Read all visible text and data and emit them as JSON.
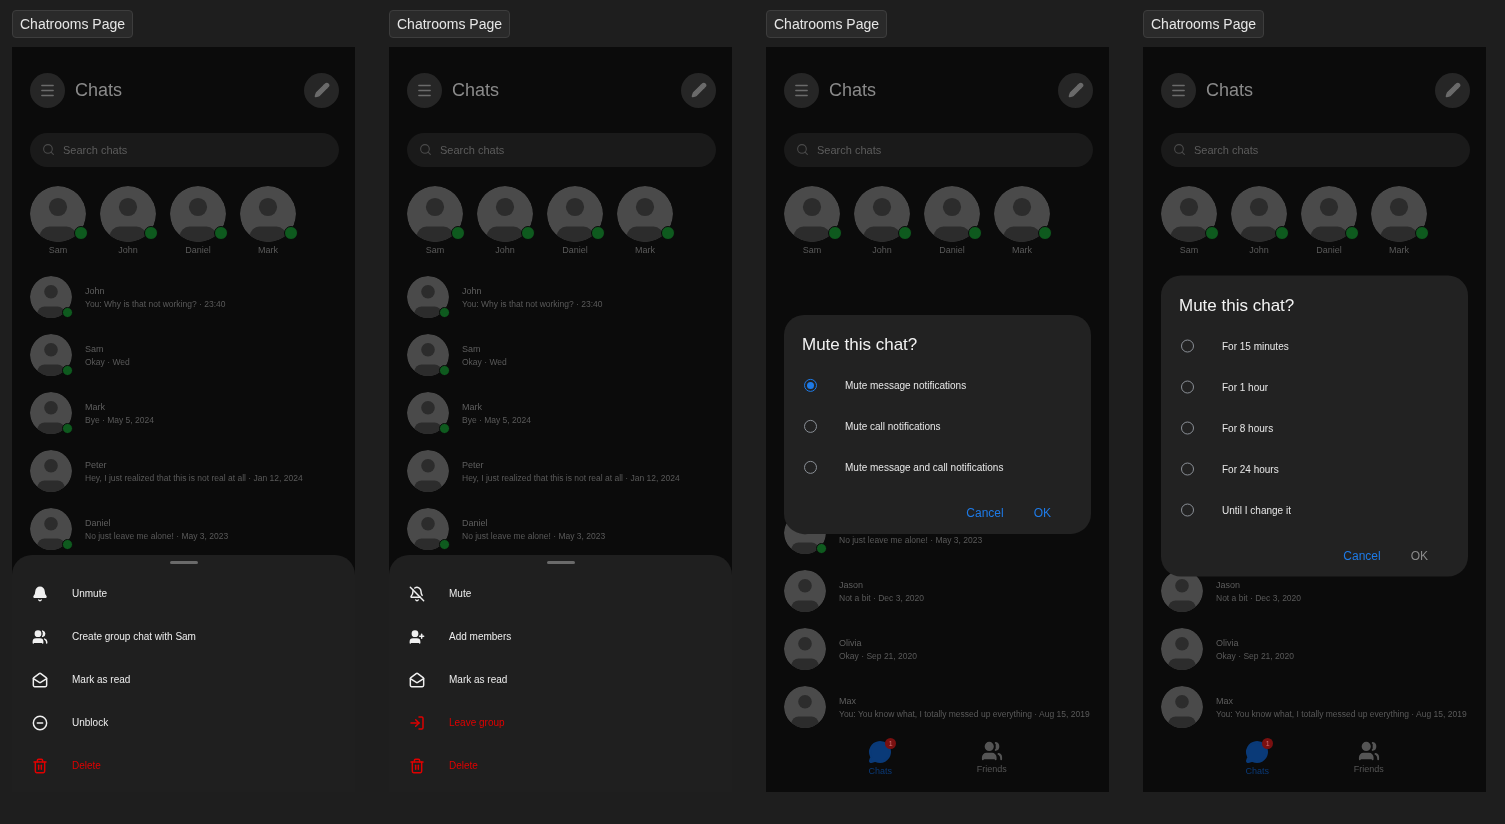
{
  "screens": [
    {
      "label": "Chatrooms Page",
      "header": {
        "title": "Chats"
      },
      "search": {
        "placeholder": "Search chats"
      },
      "stories": [
        {
          "name": "Sam",
          "online": true
        },
        {
          "name": "John",
          "online": true
        },
        {
          "name": "Daniel",
          "online": true
        },
        {
          "name": "Mark",
          "online": true
        }
      ],
      "chats": [
        {
          "name": "John",
          "preview": "You: Why is that not working? · 23:40",
          "online": true
        },
        {
          "name": "Sam",
          "preview": "Okay · Wed",
          "online": true
        },
        {
          "name": "Mark",
          "preview": "Bye · May 5, 2024",
          "online": true
        },
        {
          "name": "Peter",
          "preview": "Hey, I just realized that this is not real at all · Jan 12, 2024",
          "online": false
        },
        {
          "name": "Daniel",
          "preview": "No just leave me alone! · May 3, 2023",
          "online": true
        }
      ],
      "overlay": {
        "kind": "sheet",
        "items": [
          {
            "kind": "unmute",
            "label": "Unmute",
            "danger": false
          },
          {
            "kind": "create-group",
            "label": "Create group chat with Sam",
            "danger": false
          },
          {
            "kind": "mark-read",
            "label": "Mark as read",
            "danger": false
          },
          {
            "kind": "unblock",
            "label": "Unblock",
            "danger": false
          },
          {
            "kind": "delete",
            "label": "Delete",
            "danger": true
          }
        ]
      }
    },
    {
      "label": "Chatrooms Page",
      "header": {
        "title": "Chats"
      },
      "search": {
        "placeholder": "Search chats"
      },
      "stories": [
        {
          "name": "Sam",
          "online": true
        },
        {
          "name": "John",
          "online": true
        },
        {
          "name": "Daniel",
          "online": true
        },
        {
          "name": "Mark",
          "online": true
        }
      ],
      "chats": [
        {
          "name": "John",
          "preview": "You: Why is that not working? · 23:40",
          "online": true
        },
        {
          "name": "Sam",
          "preview": "Okay · Wed",
          "online": true
        },
        {
          "name": "Mark",
          "preview": "Bye · May 5, 2024",
          "online": true
        },
        {
          "name": "Peter",
          "preview": "Hey, I just realized that this is not real at all · Jan 12, 2024",
          "online": false
        },
        {
          "name": "Daniel",
          "preview": "No just leave me alone! · May 3, 2023",
          "online": true
        }
      ],
      "overlay": {
        "kind": "sheet",
        "items": [
          {
            "kind": "mute",
            "label": "Mute",
            "danger": false
          },
          {
            "kind": "add-members",
            "label": "Add members",
            "danger": false
          },
          {
            "kind": "mark-read",
            "label": "Mark as read",
            "danger": false
          },
          {
            "kind": "leave",
            "label": "Leave group",
            "danger": true
          },
          {
            "kind": "delete",
            "label": "Delete",
            "danger": true
          }
        ]
      }
    },
    {
      "label": "Chatrooms Page",
      "header": {
        "title": "Chats"
      },
      "search": {
        "placeholder": "Search chats"
      },
      "stories": [
        {
          "name": "Sam",
          "online": true
        },
        {
          "name": "John",
          "online": true
        },
        {
          "name": "Daniel",
          "online": true
        },
        {
          "name": "Mark",
          "online": true
        }
      ],
      "chats": [
        {
          "preview": "No just leave me alone! · May 3, 2023",
          "online": true
        },
        {
          "name": "Jason",
          "preview": "Not a bit · Dec 3, 2020",
          "online": false
        },
        {
          "name": "Olivia",
          "preview": "Okay · Sep 21, 2020",
          "online": false
        },
        {
          "name": "Max",
          "preview": "You: You know what, I totally messed up everything · Aug 15, 2019",
          "online": false
        }
      ],
      "nav": [
        {
          "kind": "chats",
          "label": "Chats",
          "selected": true,
          "badge": "1"
        },
        {
          "kind": "friends",
          "label": "Friends",
          "selected": false
        }
      ],
      "overlay": {
        "kind": "dialog",
        "title": "Mute this chat?",
        "options": [
          {
            "label": "Mute message notifications",
            "selected": true
          },
          {
            "label": "Mute call notifications",
            "selected": false
          },
          {
            "label": "Mute message and call notifications",
            "selected": false
          }
        ],
        "buttons": [
          {
            "label": "Cancel",
            "disabled": false
          },
          {
            "label": "OK",
            "disabled": false
          }
        ]
      }
    },
    {
      "label": "Chatrooms Page",
      "header": {
        "title": "Chats"
      },
      "search": {
        "placeholder": "Search chats"
      },
      "stories": [
        {
          "name": "Sam",
          "online": true
        },
        {
          "name": "John",
          "online": true
        },
        {
          "name": "Daniel",
          "online": true
        },
        {
          "name": "Mark",
          "online": true
        }
      ],
      "chats": [
        {
          "name": "Jason",
          "preview": "Not a bit · Dec 3, 2020",
          "online": false
        },
        {
          "name": "Olivia",
          "preview": "Okay · Sep 21, 2020",
          "online": false
        },
        {
          "name": "Max",
          "preview": "You: You know what, I totally messed up everything · Aug 15, 2019",
          "online": false
        }
      ],
      "nav": [
        {
          "kind": "chats",
          "label": "Chats",
          "selected": true,
          "badge": "1"
        },
        {
          "kind": "friends",
          "label": "Friends",
          "selected": false
        }
      ],
      "overlay": {
        "kind": "dialog",
        "title": "Mute this chat?",
        "options": [
          {
            "label": "For 15 minutes",
            "selected": false
          },
          {
            "label": "For 1 hour",
            "selected": false
          },
          {
            "label": "For 8 hours",
            "selected": false
          },
          {
            "label": "For 24 hours",
            "selected": false
          },
          {
            "label": "Until I change it",
            "selected": false
          }
        ],
        "buttons": [
          {
            "label": "Cancel",
            "disabled": false
          },
          {
            "label": "OK",
            "disabled": true
          }
        ]
      }
    }
  ]
}
